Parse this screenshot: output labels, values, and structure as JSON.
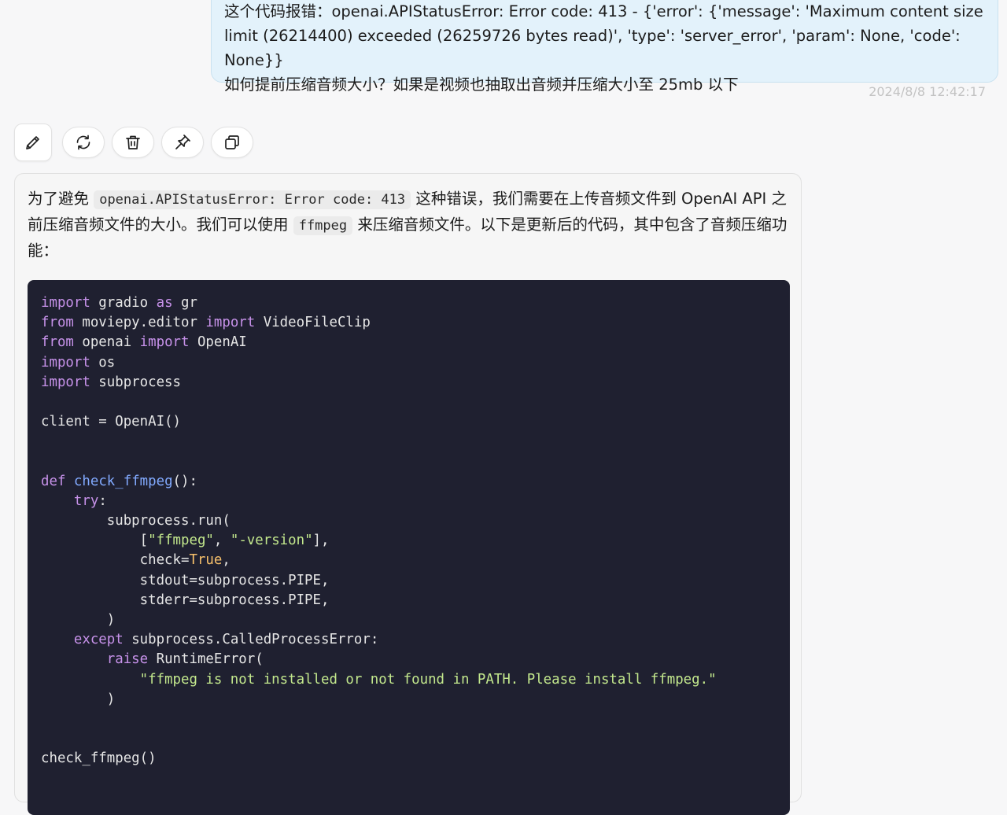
{
  "user_message": {
    "lines": [
      "这个代码报错：openai.APIStatusError: Error code: 413 - {'error': {'message': 'Maximum content size",
      "limit (26214400) exceeded (26259726 bytes read)', 'type': 'server_error', 'param': None, 'code': None}}",
      "如何提前压缩音频大小？如果是视频也抽取出音频并压缩大小至 25mb 以下"
    ],
    "timestamp": "2024/8/8 12:42:17"
  },
  "toolbar": {
    "buttons": [
      {
        "icon": "pencil-icon",
        "name": "edit-button"
      },
      {
        "icon": "refresh-icon",
        "name": "regenerate-button"
      },
      {
        "icon": "trash-icon",
        "name": "delete-button"
      },
      {
        "icon": "pin-icon",
        "name": "pin-button"
      },
      {
        "icon": "copy-icon",
        "name": "copy-button"
      }
    ]
  },
  "assistant_message": {
    "intro": {
      "t1": "为了避免 ",
      "c1": "openai.APIStatusError: Error code: 413",
      "t2": " 这种错误，我们需要在上传音频文件到 OpenAI API 之前压缩音频文件的大小。我们可以使用 ",
      "c2": "ffmpeg",
      "t3": " 来压缩音频文件。以下是更新后的代码，其中包含了音频压缩功能："
    },
    "code": {
      "colors": {
        "keyword": "#c792ea",
        "function": "#82aaff",
        "string": "#c3e88d",
        "boolean": "#f7c06b",
        "plain": "#e6e6e6",
        "background": "#1f2030"
      },
      "lines": [
        [
          {
            "t": "import",
            "c": "kw"
          },
          {
            "t": " gradio ",
            "c": "pl"
          },
          {
            "t": "as",
            "c": "kw"
          },
          {
            "t": " gr",
            "c": "pl"
          }
        ],
        [
          {
            "t": "from",
            "c": "kw"
          },
          {
            "t": " moviepy.editor ",
            "c": "pl"
          },
          {
            "t": "import",
            "c": "kw"
          },
          {
            "t": " VideoFileClip",
            "c": "pl"
          }
        ],
        [
          {
            "t": "from",
            "c": "kw"
          },
          {
            "t": " openai ",
            "c": "pl"
          },
          {
            "t": "import",
            "c": "kw"
          },
          {
            "t": " OpenAI",
            "c": "pl"
          }
        ],
        [
          {
            "t": "import",
            "c": "kw"
          },
          {
            "t": " os",
            "c": "pl"
          }
        ],
        [
          {
            "t": "import",
            "c": "kw"
          },
          {
            "t": " subprocess",
            "c": "pl"
          }
        ],
        [],
        [
          {
            "t": "client = OpenAI()",
            "c": "pl"
          }
        ],
        [],
        [],
        [
          {
            "t": "def",
            "c": "kw"
          },
          {
            "t": " ",
            "c": "pl"
          },
          {
            "t": "check_ffmpeg",
            "c": "fn"
          },
          {
            "t": "():",
            "c": "pl"
          }
        ],
        [
          {
            "t": "    ",
            "c": "pl"
          },
          {
            "t": "try",
            "c": "kw"
          },
          {
            "t": ":",
            "c": "pl"
          }
        ],
        [
          {
            "t": "        subprocess.run(",
            "c": "pl"
          }
        ],
        [
          {
            "t": "            [",
            "c": "pl"
          },
          {
            "t": "\"ffmpeg\"",
            "c": "str"
          },
          {
            "t": ", ",
            "c": "pl"
          },
          {
            "t": "\"-version\"",
            "c": "str"
          },
          {
            "t": "],",
            "c": "pl"
          }
        ],
        [
          {
            "t": "            check=",
            "c": "pl"
          },
          {
            "t": "True",
            "c": "bool"
          },
          {
            "t": ",",
            "c": "pl"
          }
        ],
        [
          {
            "t": "            stdout=subprocess.PIPE,",
            "c": "pl"
          }
        ],
        [
          {
            "t": "            stderr=subprocess.PIPE,",
            "c": "pl"
          }
        ],
        [
          {
            "t": "        )",
            "c": "pl"
          }
        ],
        [
          {
            "t": "    ",
            "c": "pl"
          },
          {
            "t": "except",
            "c": "kw"
          },
          {
            "t": " subprocess.CalledProcessError:",
            "c": "pl"
          }
        ],
        [
          {
            "t": "        ",
            "c": "pl"
          },
          {
            "t": "raise",
            "c": "kw"
          },
          {
            "t": " RuntimeError(",
            "c": "pl"
          }
        ],
        [
          {
            "t": "            ",
            "c": "pl"
          },
          {
            "t": "\"ffmpeg is not installed or not found in PATH. Please install ffmpeg.\"",
            "c": "str"
          }
        ],
        [
          {
            "t": "        )",
            "c": "pl"
          }
        ],
        [],
        [],
        [
          {
            "t": "check_ffmpeg()",
            "c": "pl"
          }
        ]
      ]
    }
  }
}
